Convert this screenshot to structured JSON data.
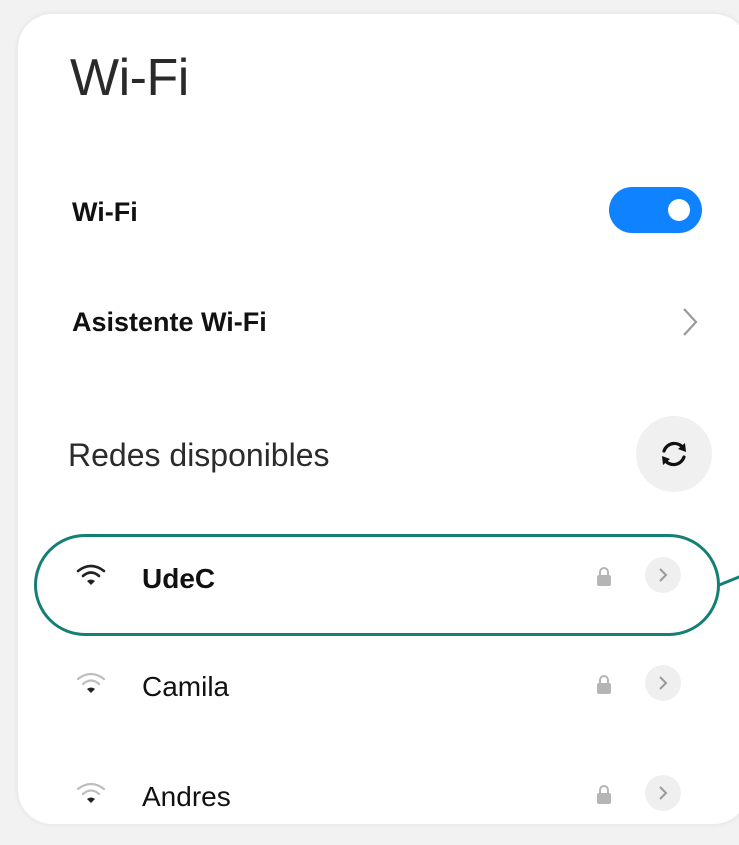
{
  "page": {
    "title": "Wi-Fi"
  },
  "settings": {
    "wifi_label": "Wi-Fi",
    "wifi_enabled": true,
    "assistant_label": "Asistente Wi-Fi"
  },
  "available": {
    "section_title": "Redes disponibles",
    "refresh_icon": "refresh-icon",
    "networks": [
      {
        "name": "UdeC",
        "secured": true,
        "signal_color": "#222222"
      },
      {
        "name": "Camila",
        "secured": true,
        "signal_color": "#bdbdbd"
      },
      {
        "name": "Andres",
        "secured": true,
        "signal_color": "#bdbdbd"
      }
    ]
  },
  "colors": {
    "toggle_on": "#0f83ff",
    "highlight": "#147f73"
  }
}
